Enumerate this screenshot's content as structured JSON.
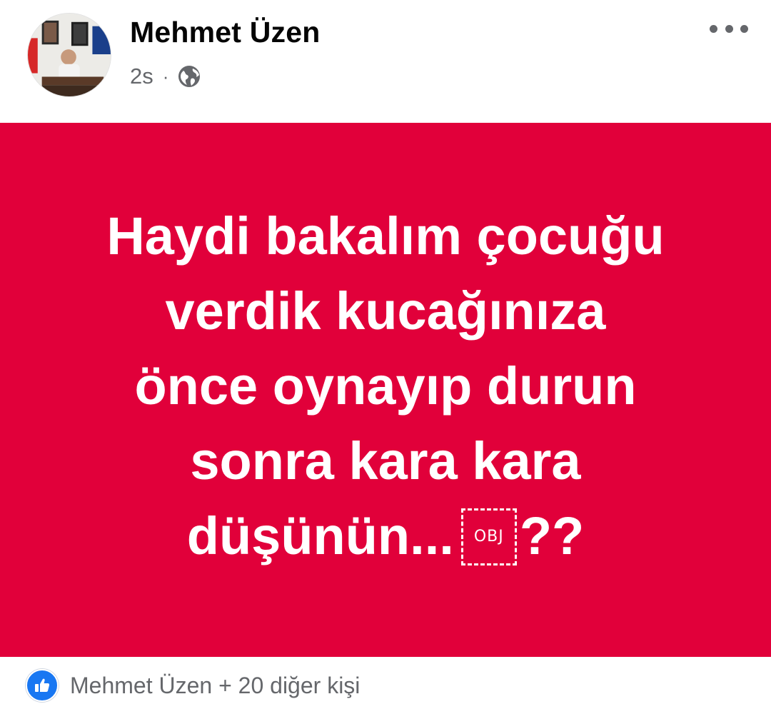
{
  "post": {
    "author": "Mehmet Üzen",
    "time": "2s",
    "separator": "·",
    "privacy_icon": "globe-icon",
    "menu_icon": "more-options-icon"
  },
  "card": {
    "background": "#e1003a",
    "text_color": "#ffffff",
    "lines": [
      "Haydi bakalım çocuğu",
      "verdik kucağınıza",
      "önce oynayıp durun",
      "sonra kara kara",
      "düşünün..."
    ],
    "obj_placeholder": "OBJ",
    "trailing_marks": "??"
  },
  "reactions": {
    "icon": "like-icon",
    "accent": "#1877f2",
    "summary": "Mehmet Üzen + 20 diğer kişi"
  }
}
